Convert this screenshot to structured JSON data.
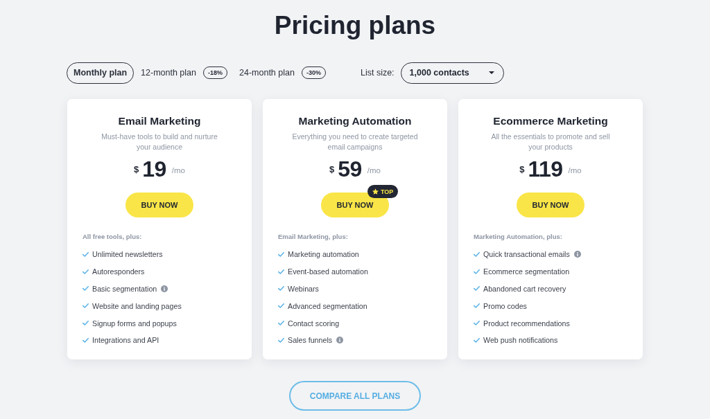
{
  "title": "Pricing plans",
  "billing_options": [
    {
      "label": "Monthly plan",
      "selected": true
    },
    {
      "label": "12-month plan",
      "badge": "-18%",
      "selected": false
    },
    {
      "label": "24-month plan",
      "badge": "-30%",
      "selected": false
    }
  ],
  "list_size": {
    "label": "List size:",
    "value": "1,000 contacts"
  },
  "plans": [
    {
      "name": "Email Marketing",
      "description": "Must-have tools to build and nurture your audience",
      "currency": "$",
      "price": "19",
      "period": "/mo",
      "button": "BUY NOW",
      "features_heading": "All free tools, plus:",
      "features": [
        {
          "label": "Unlimited newsletters",
          "info": false
        },
        {
          "label": "Autoresponders",
          "info": false
        },
        {
          "label": "Basic segmentation",
          "info": true
        },
        {
          "label": "Website and landing pages",
          "info": false
        },
        {
          "label": "Signup forms and popups",
          "info": false
        },
        {
          "label": "Integrations and API",
          "info": false
        }
      ]
    },
    {
      "name": "Marketing Automation",
      "description": "Everything you need to create targeted email campaigns",
      "currency": "$",
      "price": "59",
      "period": "/mo",
      "button": "BUY NOW",
      "badge": "TOP",
      "features_heading": "Email Marketing, plus:",
      "features": [
        {
          "label": "Marketing automation",
          "info": false
        },
        {
          "label": "Event-based automation",
          "info": false
        },
        {
          "label": "Webinars",
          "info": false
        },
        {
          "label": "Advanced segmentation",
          "info": false
        },
        {
          "label": "Contact scoring",
          "info": false
        },
        {
          "label": "Sales funnels",
          "info": true
        }
      ]
    },
    {
      "name": "Ecommerce Marketing",
      "description": "All the essentials to promote and sell your products",
      "currency": "$",
      "price": "119",
      "period": "/mo",
      "button": "BUY NOW",
      "features_heading": "Marketing Automation, plus:",
      "features": [
        {
          "label": "Quick transactional emails",
          "info": true
        },
        {
          "label": "Ecommerce segmentation",
          "info": false
        },
        {
          "label": "Abandoned cart recovery",
          "info": false
        },
        {
          "label": "Promo codes",
          "info": false
        },
        {
          "label": "Product recommendations",
          "info": false
        },
        {
          "label": "Web push notifications",
          "info": false
        }
      ]
    }
  ],
  "compare_button": "COMPARE ALL PLANS"
}
